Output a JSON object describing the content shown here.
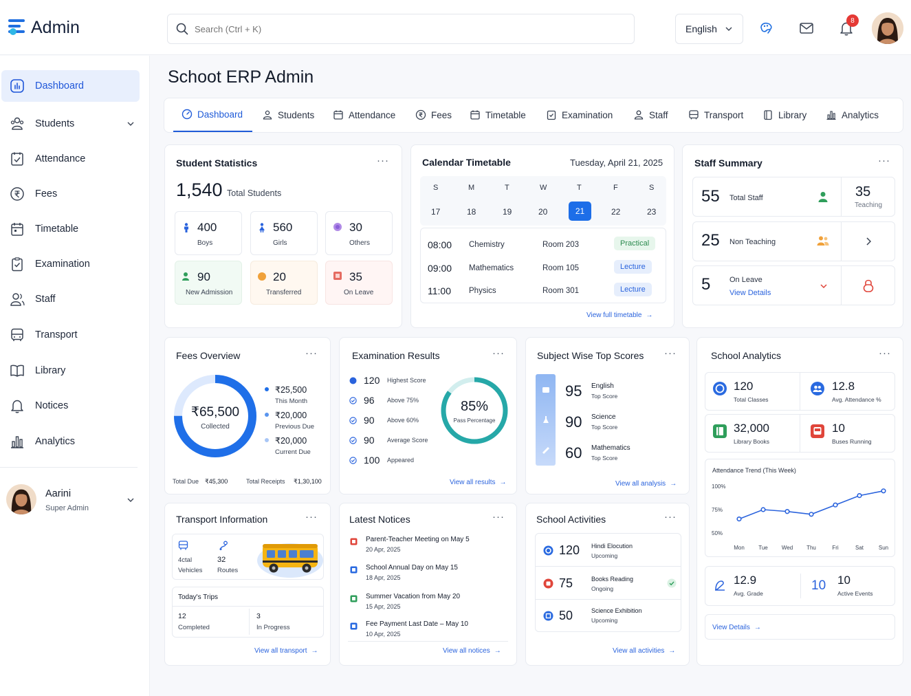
{
  "app": {
    "title": "Admin"
  },
  "header": {
    "search_placeholder": "Search (Ctrl + K)",
    "language": "English",
    "notif_count": "8"
  },
  "sidebar": {
    "items": [
      {
        "label": "Dashboard"
      },
      {
        "label": "Students"
      },
      {
        "label": "Attendance"
      },
      {
        "label": "Fees"
      },
      {
        "label": "Timetable"
      },
      {
        "label": "Examination"
      },
      {
        "label": "Staff"
      },
      {
        "label": "Transport"
      },
      {
        "label": "Library"
      },
      {
        "label": "Notices"
      },
      {
        "label": "Analytics"
      }
    ],
    "user": {
      "name": "Aarini",
      "role": "Super Admin"
    }
  },
  "page": {
    "title": "Schoot ERP Admin"
  },
  "tabs": [
    "Dashboard",
    "Students",
    "Attendance",
    "Fees",
    "Timetable",
    "Examination",
    "Staff",
    "Transport",
    "Library",
    "Analytics"
  ],
  "student_stats": {
    "title": "Student Statistics",
    "total": "1,540",
    "total_label": "Total Students",
    "items": [
      {
        "value": "400",
        "label": "Boys"
      },
      {
        "value": "560",
        "label": "Girls"
      },
      {
        "value": "30",
        "label": "Others"
      },
      {
        "value": "90",
        "label": "New Admission"
      },
      {
        "value": "20",
        "label": "Transferred"
      },
      {
        "value": "35",
        "label": "On Leave"
      }
    ]
  },
  "calendar": {
    "title": "Calendar Timetable",
    "date": "Tuesday, April 21, 2025",
    "days": [
      "S",
      "M",
      "T",
      "W",
      "T",
      "F",
      "S"
    ],
    "dates": [
      "17",
      "18",
      "19",
      "20",
      "21",
      "22",
      "23"
    ],
    "classes": [
      {
        "time": "08:00",
        "subject": "Chemistry",
        "room": "Room 203",
        "type": "Practical"
      },
      {
        "time": "09:00",
        "subject": "Mathematics",
        "room": "Room 105",
        "type": "Lecture"
      },
      {
        "time": "11:00",
        "subject": "Physics",
        "room": "Room 301",
        "type": "Lecture"
      }
    ],
    "link": "View full timetable"
  },
  "staff": {
    "title": "Staff Summary",
    "total": "55",
    "total_label": "Total Staff",
    "teaching": "35",
    "teaching_label": "Teaching",
    "non_teaching": "25",
    "non_teaching_label": "Non Teaching",
    "on_leave": "5",
    "on_leave_label": "On Leave",
    "details": "View Details"
  },
  "fees": {
    "title": "Fees Overview",
    "collected": "₹65,500",
    "collected_label": "Collected",
    "collected_fraction": 0.75,
    "legend": [
      {
        "amount": "₹25,500",
        "label": "This Month"
      },
      {
        "amount": "₹20,000",
        "label": "Previous Due"
      },
      {
        "amount": "₹20,000",
        "label": "Current Due"
      }
    ],
    "total_due_label": "Total Due",
    "total_due": "₹45,300",
    "total_receipts_label": "Total Receipts",
    "total_receipts": "₹1,30,100"
  },
  "exam": {
    "title": "Examination Results",
    "items": [
      {
        "value": "120",
        "label": "Highest Score"
      },
      {
        "value": "96",
        "label": "Above 75%"
      },
      {
        "value": "90",
        "label": "Above 60%"
      },
      {
        "value": "90",
        "label": "Average Score"
      },
      {
        "value": "100",
        "label": "Appeared"
      }
    ],
    "pass_pct": "85%",
    "pass_label": "Pass Percentage",
    "pass_fraction": 0.85,
    "link": "View all results"
  },
  "subjects": {
    "title": "Subject Wise Top Scores",
    "items": [
      {
        "score": "95",
        "name": "English",
        "label": "Top Score"
      },
      {
        "score": "90",
        "name": "Science",
        "label": "Top Score"
      },
      {
        "score": "60",
        "name": "Mathematics",
        "label": "Top Score"
      }
    ],
    "link": "View all analysis"
  },
  "analytics": {
    "title": "School Analytics",
    "stats": [
      {
        "value": "120",
        "label": "Total Classes"
      },
      {
        "value": "12.8",
        "label": "Avg. Attendance %"
      },
      {
        "value": "32,000",
        "label": "Library Books"
      },
      {
        "value": "10",
        "label": "Buses Running"
      }
    ],
    "grade": "12.9",
    "grade_label": "Avg. Grade",
    "events_icon_value": "10",
    "events": "10",
    "events_label": "Active Events",
    "link": "View Details"
  },
  "transport": {
    "title": "Transport Information",
    "vehicles_label_1": "4ctal",
    "vehicles_label_2": "Vehicles",
    "routes": "32",
    "routes_label": "Routes",
    "trips_title": "Today's Trips",
    "completed": "12",
    "completed_label": "Completed",
    "in_progress": "3",
    "in_progress_label": "In Progress",
    "link": "View all transport"
  },
  "notices": {
    "title": "Latest Notices",
    "items": [
      {
        "title": "Parent-Teacher Meeting on May 5",
        "date": "20 Apr, 2025",
        "color": "#e0453a"
      },
      {
        "title": "School Annual Day on May 15",
        "date": "18 Apr, 2025",
        "color": "#2a6ae0"
      },
      {
        "title": "Summer Vacation from May 20",
        "date": "15 Apr, 2025",
        "color": "#2f9e5b"
      },
      {
        "title": "Fee Payment Last Date – May 10",
        "date": "10 Apr, 2025",
        "color": "#2a6ae0"
      }
    ],
    "link": "View all notices"
  },
  "activities": {
    "title": "School Activities",
    "items": [
      {
        "value": "120",
        "name": "Hindi Elocution",
        "status": "Upcoming",
        "color": "#2a6ae0"
      },
      {
        "value": "75",
        "name": "Books Reading",
        "status": "Ongoing",
        "color": "#e0453a"
      },
      {
        "value": "50",
        "name": "Science Exhibition",
        "status": "Upcoming",
        "color": "#2a6ae0"
      }
    ],
    "link": "View all activities"
  },
  "chart_data": {
    "type": "line",
    "title": "Attendance Trend (This Week)",
    "categories": [
      "Mon",
      "Tue",
      "Wed",
      "Thu",
      "Fri",
      "Sat",
      "Sun"
    ],
    "values": [
      65,
      75,
      73,
      70,
      80,
      90,
      95
    ],
    "yticks": [
      "100%",
      "75%",
      "50%"
    ],
    "ylim": [
      50,
      100
    ],
    "color": "#2a63dd"
  }
}
